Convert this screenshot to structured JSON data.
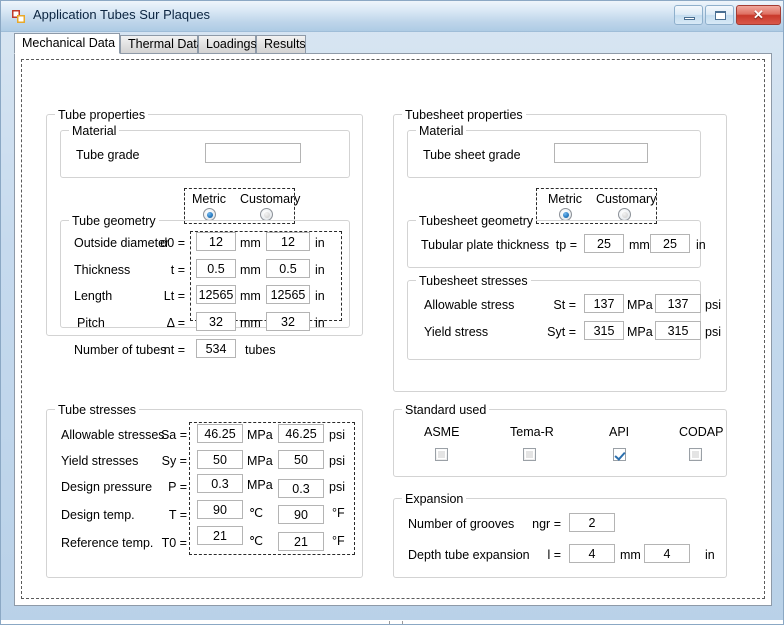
{
  "window": {
    "title": "Application Tubes Sur Plaques",
    "icon": "vs-form-icon",
    "buttons": {
      "minimize": "minimize-icon",
      "maximize": "maximize-icon",
      "close": "✕"
    }
  },
  "tabs": [
    {
      "label": "Mechanical Data",
      "active": true
    },
    {
      "label": "Thermal Data",
      "active": false
    },
    {
      "label": "Loadings",
      "active": false
    },
    {
      "label": "Results",
      "active": false
    }
  ],
  "tube_properties": {
    "title": "Tube properties",
    "material": {
      "title": "Material",
      "grade_label": "Tube grade",
      "grade_value": ""
    },
    "units": {
      "metric_label": "Metric",
      "customary_label": "Customary",
      "selected": "Metric"
    },
    "geometry": {
      "title": "Tube geometry",
      "rows": [
        {
          "label": "Outside diameter",
          "symbol": "d0 =",
          "metric_value": "12",
          "metric_unit": "mm",
          "customary_value": "12",
          "customary_unit": "in"
        },
        {
          "label": "Thickness",
          "symbol": "t =",
          "metric_value": "0.5",
          "metric_unit": "mm",
          "customary_value": "0.5",
          "customary_unit": "in"
        },
        {
          "label": "Length",
          "symbol": "Lt =",
          "metric_value": "12565",
          "metric_unit": "mm",
          "customary_value": "12565",
          "customary_unit": "in"
        },
        {
          "label": "Pitch",
          "symbol": "Δ =",
          "metric_value": "32",
          "metric_unit": "mm",
          "customary_value": "32",
          "customary_unit": "in"
        },
        {
          "label": "Number of tubes",
          "symbol": "nt =",
          "metric_value": "534",
          "metric_unit": "tubes",
          "customary_value": "",
          "customary_unit": ""
        }
      ]
    },
    "stresses": {
      "title": "Tube stresses",
      "rows": [
        {
          "label": "Allowable stresses",
          "symbol": "Sa =",
          "metric_value": "46.25",
          "metric_unit": "MPa",
          "customary_value": "46.25",
          "customary_unit": "psi"
        },
        {
          "label": "Yield stresses",
          "symbol": "Sy =",
          "metric_value": "50",
          "metric_unit": "MPa",
          "customary_value": "50",
          "customary_unit": "psi"
        },
        {
          "label": "Design pressure",
          "symbol": "P =",
          "metric_value": "0.3",
          "metric_unit": "MPa",
          "customary_value": "0.3",
          "customary_unit": "psi"
        },
        {
          "label": "Design temp.",
          "symbol": "T =",
          "metric_value": "90",
          "metric_unit": "℃",
          "customary_value": "90",
          "customary_unit": "°F"
        },
        {
          "label": "Reference temp.",
          "symbol": "T0 =",
          "metric_value": "21",
          "metric_unit": "℃",
          "customary_value": "21",
          "customary_unit": "°F"
        }
      ]
    }
  },
  "tubesheet_properties": {
    "title": "Tubesheet properties",
    "material": {
      "title": "Material",
      "grade_label": "Tube sheet grade",
      "grade_value": ""
    },
    "units": {
      "metric_label": "Metric",
      "customary_label": "Customary",
      "selected": "Metric"
    },
    "geometry": {
      "title": "Tubesheet geometry",
      "rows": [
        {
          "label": "Tubular plate thickness",
          "symbol": "tp =",
          "metric_value": "25",
          "metric_unit": "mm",
          "customary_value": "25",
          "customary_unit": "in"
        }
      ]
    },
    "stresses": {
      "title": "Tubesheet stresses",
      "rows": [
        {
          "label": "Allowable stress",
          "symbol": "St =",
          "metric_value": "137",
          "metric_unit": "MPa",
          "customary_value": "137",
          "customary_unit": "psi"
        },
        {
          "label": "Yield stress",
          "symbol": "Syt =",
          "metric_value": "315",
          "metric_unit": "MPa",
          "customary_value": "315",
          "customary_unit": "psi"
        }
      ]
    }
  },
  "standard_used": {
    "title": "Standard used",
    "options": [
      {
        "label": "ASME",
        "checked": false
      },
      {
        "label": "Tema-R",
        "checked": false
      },
      {
        "label": "API",
        "checked": true
      },
      {
        "label": "CODAP",
        "checked": false
      }
    ]
  },
  "expansion": {
    "title": "Expansion",
    "rows": [
      {
        "label": "Number of grooves",
        "symbol": "ngr =",
        "metric_value": "2",
        "metric_unit": "",
        "customary_value": "",
        "customary_unit": ""
      },
      {
        "label": "Depth tube expansion",
        "symbol": "l =",
        "metric_value": "4",
        "metric_unit": "mm",
        "customary_value": "4",
        "customary_unit": "in"
      }
    ]
  },
  "colors": {
    "accent": "#2a7ec4",
    "titlebar": "#bed5ea",
    "close": "#c9392b"
  }
}
